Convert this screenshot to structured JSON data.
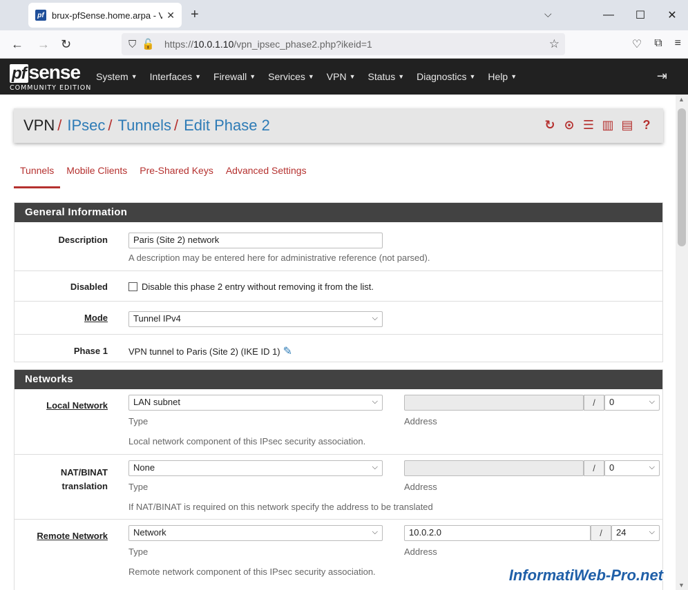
{
  "browser": {
    "tab_title": "brux-pfSense.home.arpa - VPN",
    "url_prefix": "https://",
    "url_host": "10.0.1.10",
    "url_path": "/vpn_ipsec_phase2.php?ikeid=1"
  },
  "logo": {
    "pf": "pf",
    "sense": "sense",
    "edition": "COMMUNITY EDITION"
  },
  "menu": [
    "System",
    "Interfaces",
    "Firewall",
    "Services",
    "VPN",
    "Status",
    "Diagnostics",
    "Help"
  ],
  "breadcrumb": {
    "root": "VPN",
    "items": [
      "IPsec",
      "Tunnels",
      "Edit Phase 2"
    ],
    "separator": "/"
  },
  "tabs": [
    "Tunnels",
    "Mobile Clients",
    "Pre-Shared Keys",
    "Advanced Settings"
  ],
  "general": {
    "header": "General Information",
    "description_label": "Description",
    "description_value": "Paris (Site 2) network",
    "description_help": "A description may be entered here for administrative reference (not parsed).",
    "disabled_label": "Disabled",
    "disabled_text": "Disable this phase 2 entry without removing it from the list.",
    "mode_label": "Mode",
    "mode_value": "Tunnel IPv4",
    "phase1_label": "Phase 1",
    "phase1_value": "VPN tunnel to Paris (Site 2) (IKE ID 1)"
  },
  "networks": {
    "header": "Networks",
    "local_label": "Local Network",
    "local_type": "LAN subnet",
    "local_address": "",
    "local_mask": "0",
    "local_help": "Local network component of this IPsec security association.",
    "nat_label_1": "NAT/BINAT",
    "nat_label_2": "translation",
    "nat_type": "None",
    "nat_address": "",
    "nat_mask": "0",
    "nat_help": "If NAT/BINAT is required on this network specify the address to be translated",
    "remote_label": "Remote Network",
    "remote_type": "Network",
    "remote_address": "10.0.2.0",
    "remote_mask": "24",
    "remote_help": "Remote network component of this IPsec security association.",
    "type_label": "Type",
    "address_label": "Address",
    "slash": "/"
  },
  "watermark": "InformatiWeb-Pro.net"
}
